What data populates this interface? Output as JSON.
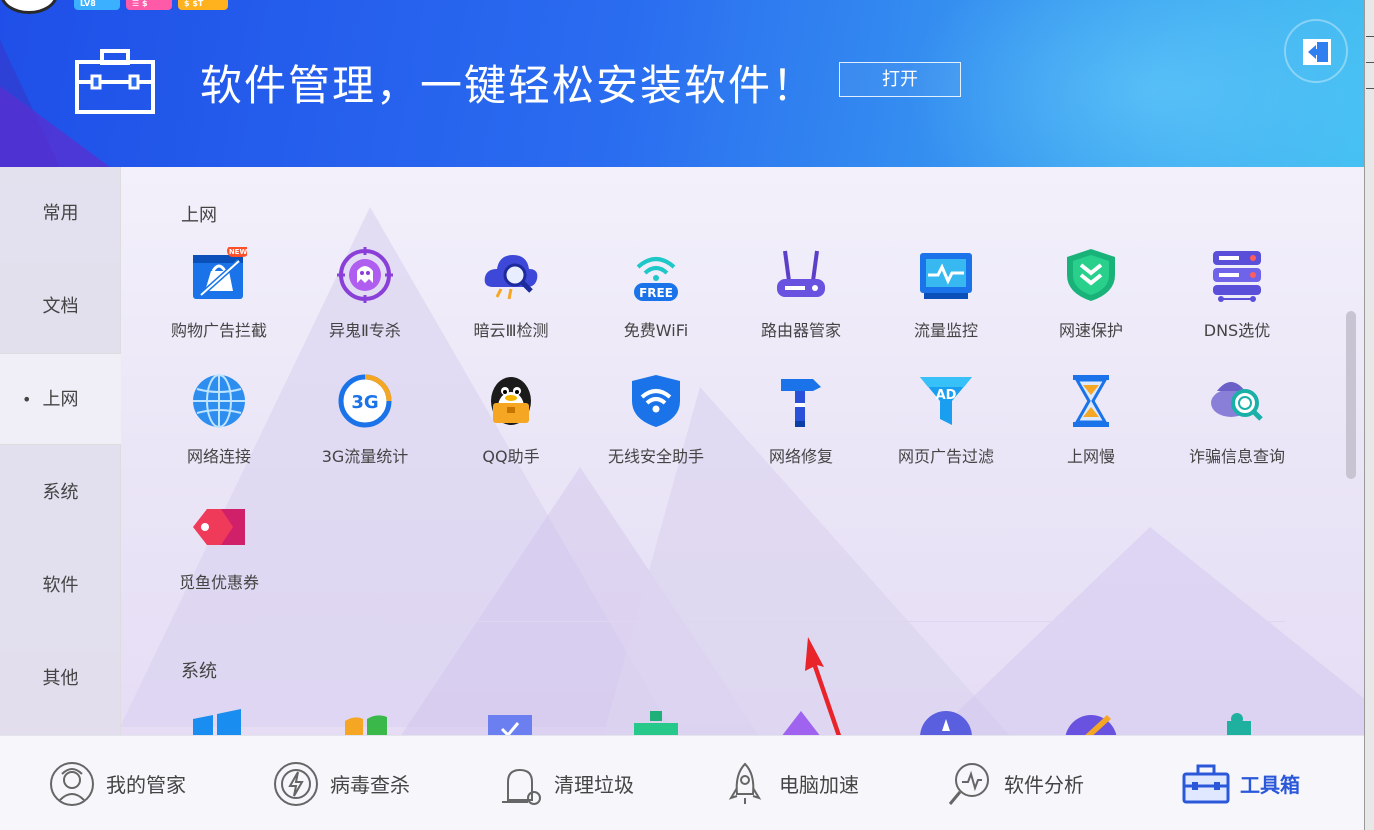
{
  "header": {
    "badges": [
      "LV8",
      "☰ $",
      "$ $T"
    ],
    "banner_title": "软件管理，一键轻松安装软件！",
    "open_button": "打开"
  },
  "sidebar": {
    "items": [
      {
        "label": "常用"
      },
      {
        "label": "文档"
      },
      {
        "label": "上网",
        "active": true
      },
      {
        "label": "系统"
      },
      {
        "label": "软件"
      },
      {
        "label": "其他"
      }
    ]
  },
  "sections": {
    "internet": {
      "title": "上网",
      "tiles": [
        {
          "label": "购物广告拦截",
          "icon": "shopping-adblock-icon",
          "badge": "NEW"
        },
        {
          "label": "异鬼Ⅱ专杀",
          "icon": "ghost-target-icon"
        },
        {
          "label": "暗云Ⅲ检测",
          "icon": "cloud-search-icon"
        },
        {
          "label": "免费WiFi",
          "icon": "free-wifi-icon",
          "icon_text": "FREE"
        },
        {
          "label": "路由器管家",
          "icon": "router-icon"
        },
        {
          "label": "流量监控",
          "icon": "traffic-monitor-icon"
        },
        {
          "label": "网速保护",
          "icon": "speed-shield-icon"
        },
        {
          "label": "DNS选优",
          "icon": "dns-server-icon"
        },
        {
          "label": "网络连接",
          "icon": "globe-icon"
        },
        {
          "label": "3G流量统计",
          "icon": "3g-icon",
          "icon_text": "3G"
        },
        {
          "label": "QQ助手",
          "icon": "qq-penguin-icon"
        },
        {
          "label": "无线安全助手",
          "icon": "wifi-shield-icon"
        },
        {
          "label": "网络修复",
          "icon": "hammer-icon"
        },
        {
          "label": "网页广告过滤",
          "icon": "ad-filter-icon",
          "icon_text": "AD"
        },
        {
          "label": "上网慢",
          "icon": "hourglass-icon"
        },
        {
          "label": "诈骗信息查询",
          "icon": "fraud-search-icon"
        },
        {
          "label": "觅鱼优惠券",
          "icon": "coupon-tag-icon"
        }
      ]
    },
    "system": {
      "title": "系统"
    }
  },
  "bottom_nav": [
    {
      "label": "我的管家",
      "icon": "butler-avatar-icon"
    },
    {
      "label": "病毒查杀",
      "icon": "virus-scan-icon"
    },
    {
      "label": "清理垃圾",
      "icon": "vacuum-icon"
    },
    {
      "label": "电脑加速",
      "icon": "rocket-icon"
    },
    {
      "label": "软件分析",
      "icon": "software-analysis-icon"
    },
    {
      "label": "工具箱",
      "icon": "toolbox-icon",
      "active": true
    }
  ],
  "colors": {
    "header_start": "#1f4fe8",
    "header_end": "#45c0f2",
    "active_nav": "#2b58d8",
    "annotation_arrow": "#e8242a"
  }
}
